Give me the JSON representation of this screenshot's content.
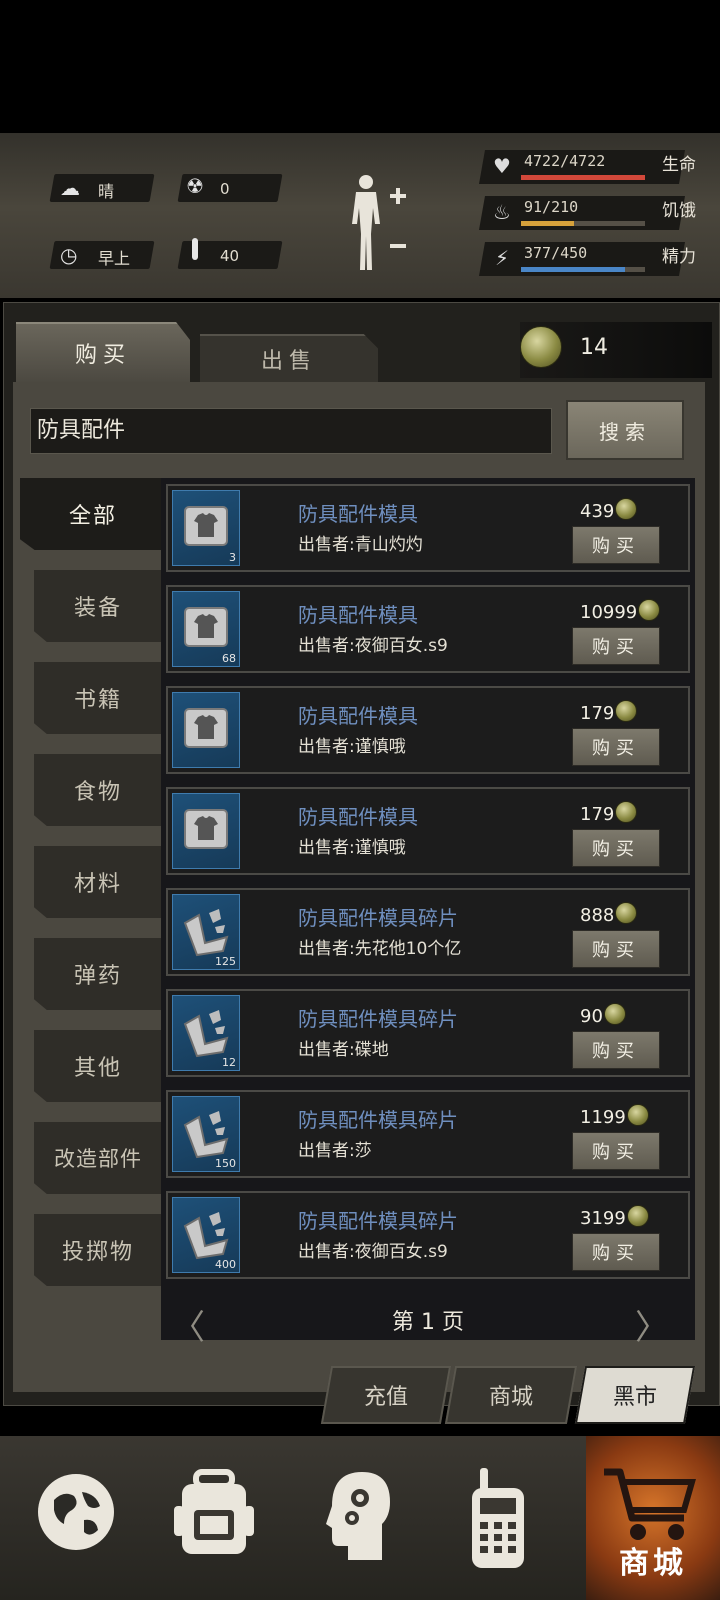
{
  "status": {
    "weather": "晴",
    "radiation": "0",
    "time_of_day": "早上",
    "temperature": "40",
    "health": {
      "value": "4722/4722",
      "label": "生命",
      "fraction": 1.0,
      "color": "#d2483a"
    },
    "hunger": {
      "value": "91/210",
      "label": "饥饿",
      "fraction": 0.43,
      "color": "#d6a13b"
    },
    "energy": {
      "value": "377/450",
      "label": "精力",
      "fraction": 0.84,
      "color": "#4a86c7"
    }
  },
  "shop": {
    "tabs": {
      "buy": "购买",
      "sell": "出售"
    },
    "coins": "14",
    "search": {
      "value": "防具配件",
      "button": "搜索"
    },
    "categories": [
      "全部",
      "装备",
      "书籍",
      "食物",
      "材料",
      "弹药",
      "其他",
      "改造部件",
      "投掷物"
    ],
    "buy_label": "购买",
    "items": [
      {
        "name": "防具配件模具",
        "seller": "出售者:青山灼灼",
        "price": "439",
        "qty": "3",
        "icon": "armor-mold-icon"
      },
      {
        "name": "防具配件模具",
        "seller": "出售者:夜御百女.s9",
        "price": "10999",
        "qty": "68",
        "icon": "armor-mold-icon"
      },
      {
        "name": "防具配件模具",
        "seller": "出售者:谨慎哦",
        "price": "179",
        "qty": "",
        "icon": "armor-mold-icon"
      },
      {
        "name": "防具配件模具",
        "seller": "出售者:谨慎哦",
        "price": "179",
        "qty": "",
        "icon": "armor-mold-icon"
      },
      {
        "name": "防具配件模具碎片",
        "seller": "出售者:先花他10个亿",
        "price": "888",
        "qty": "125",
        "icon": "mold-fragment-icon"
      },
      {
        "name": "防具配件模具碎片",
        "seller": "出售者:碟地",
        "price": "90",
        "qty": "12",
        "icon": "mold-fragment-icon"
      },
      {
        "name": "防具配件模具碎片",
        "seller": "出售者:莎",
        "price": "1199",
        "qty": "150",
        "icon": "mold-fragment-icon"
      },
      {
        "name": "防具配件模具碎片",
        "seller": "出售者:夜御百女.s9",
        "price": "3199",
        "qty": "400",
        "icon": "mold-fragment-icon"
      }
    ],
    "page_label": "第 1 页",
    "subtabs": [
      "充值",
      "商城",
      "黑市"
    ],
    "active_subtab": "黑市"
  },
  "nav": {
    "shop_label": "商城",
    "active": "shop"
  }
}
